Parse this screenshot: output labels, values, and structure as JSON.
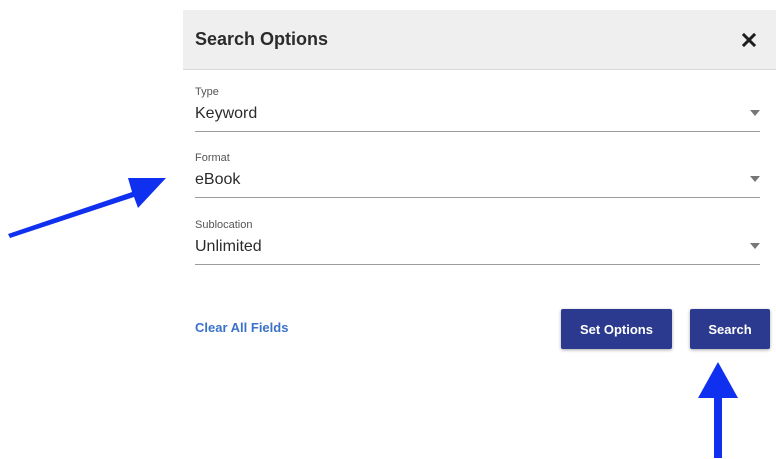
{
  "dialog": {
    "title": "Search Options",
    "close_icon": "close-icon"
  },
  "fields": [
    {
      "label": "Type",
      "value": "Keyword"
    },
    {
      "label": "Format",
      "value": "eBook"
    },
    {
      "label": "Sublocation",
      "value": "Unlimited"
    }
  ],
  "actions": {
    "clear_label": "Clear All Fields",
    "set_options_label": "Set Options",
    "search_label": "Search"
  },
  "colors": {
    "header_bg": "#efefef",
    "button_bg": "#2b3a8f",
    "link": "#3a72c9",
    "annotation_arrow": "#1030f0"
  },
  "annotations": {
    "arrow_icon": "arrow-icon"
  }
}
